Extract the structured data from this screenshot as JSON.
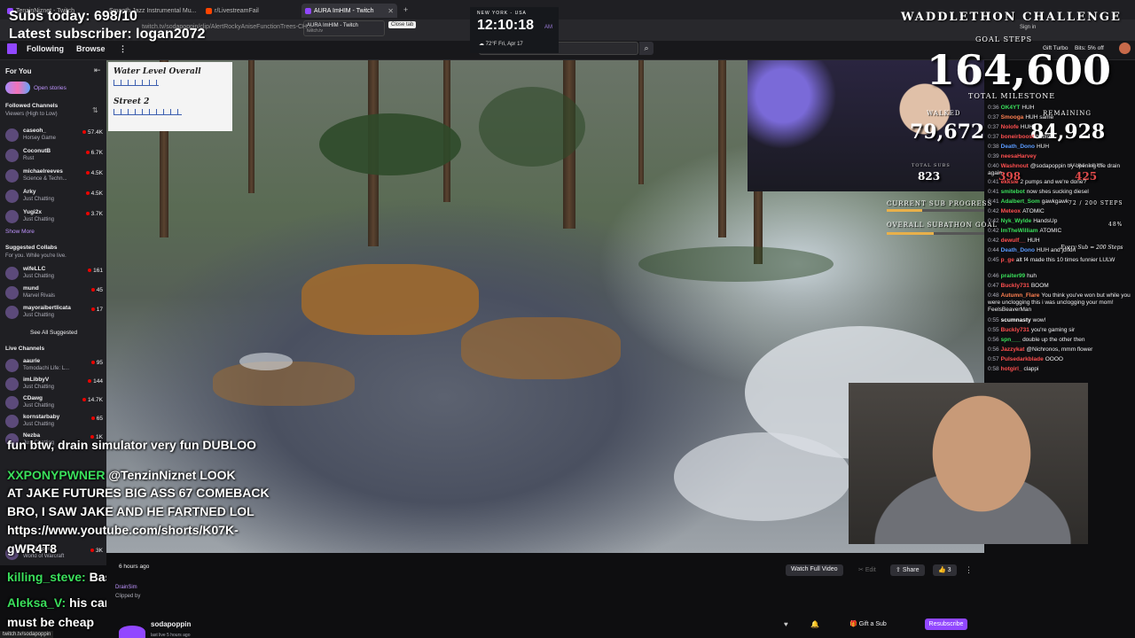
{
  "browser": {
    "tabs": [
      {
        "label": "TenzinNiznet - Twitch",
        "color": "#9147ff"
      },
      {
        "label": "Smooth Jazz Instrumental Mu...",
        "color": "#e03030"
      },
      {
        "label": "r/LivestreamFail",
        "color": "#ff4500"
      },
      {
        "label": "AURA ImHIM - Twitch",
        "color": "#9147ff"
      }
    ],
    "tab_tooltip": "AURA ImHIM - Twitch",
    "tab_tooltip_sub": "twitch.tv",
    "close_tab_tooltip": "Close tab",
    "url": "twitch.tv/sodapoppin/clip/AlertRockyAniseFunctionTrees-CH...",
    "sign_in": "Sign in",
    "gift_turbo": "Gift Turbo",
    "bits": "Bits: 5% off"
  },
  "nav": {
    "following": "Following",
    "browse": "Browse",
    "more": "⋮"
  },
  "sidebar": {
    "for_you": "For You",
    "open_stories": "Open stories",
    "followed_title": "Followed Channels",
    "followed_sort": "Viewers (High to Low)",
    "followed": [
      {
        "name": "caseoh_",
        "game": "Horsey Game",
        "viewers": "57.4K"
      },
      {
        "name": "CoconutB",
        "game": "Rust",
        "viewers": "6.7K"
      },
      {
        "name": "michaelreeves",
        "game": "Science & Techn...",
        "viewers": "4.5K"
      },
      {
        "name": "Arky",
        "game": "Just Chatting",
        "viewers": "4.5K"
      },
      {
        "name": "Yugi2x",
        "game": "Just Chatting",
        "viewers": "3.7K"
      }
    ],
    "show_more": "Show More",
    "suggested_title": "Suggested Collabs",
    "suggested_sub": "For you. While you're live.",
    "suggested": [
      {
        "name": "wifeLLC",
        "game": "Just Chatting",
        "viewers": "161"
      },
      {
        "name": "mund",
        "game": "Marvel Rivals",
        "viewers": "45"
      },
      {
        "name": "mayoraibertlicata",
        "game": "Just Chatting",
        "viewers": "17"
      }
    ],
    "see_all": "See All Suggested",
    "live_title": "Live Channels",
    "live": [
      {
        "name": "aaurie",
        "game": "Tomodachi Life: L...",
        "viewers": "95"
      },
      {
        "name": "imLibbyV",
        "game": "Just Chatting",
        "viewers": "144"
      },
      {
        "name": "CDawg",
        "game": "Just Chatting",
        "viewers": "14.7K"
      },
      {
        "name": "kornstarbaby",
        "game": "Just Chatting",
        "viewers": "65"
      },
      {
        "name": "Nezba",
        "game": "Just Chatting",
        "viewers": "1K"
      }
    ],
    "bottom_channel": {
      "name": "Pikaboom",
      "game": "World of Warcraft",
      "viewers": "3K"
    }
  },
  "overlay": {
    "subs_today": "Subs today: 698/10",
    "latest_sub": "Latest subscriber: logan2072",
    "water_title": "Water Level Overall",
    "street_title": "Street 2",
    "water_level": 0.4,
    "street_level": 0.6
  },
  "clock": {
    "city": "NEW YORK - USA",
    "time": "12:10:18",
    "ampm": "AM",
    "weather": "☁ 72°F  Fri, Apr 17"
  },
  "stats": {
    "title": "WADDLETHON CHALLENGE",
    "goal_steps": "GOAL STEPS",
    "big_number": "164,600",
    "total_milestone": "TOTAL MILESTONE",
    "walked_label": "WALKED",
    "walked": "79,672",
    "remaining_label": "REMAINING",
    "remaining": "84,928",
    "total_subs_label": "TOTAL SUBS",
    "total_subs": "823",
    "subs_count": "398",
    "subs_left_label": "SUBS LEFT",
    "subs_left": "425",
    "current_label": "CURRENT SUB PROGRESS",
    "current_value": "72 / 200 STEPS",
    "current_fraction": 0.36,
    "overall_label": "OVERALL SUBATHON GOAL",
    "overall_value": "48%",
    "overall_fraction": 0.48,
    "every_sub": "Every Sub = 200 Steps"
  },
  "chat": [
    {
      "t": "0:36",
      "u": "OK4YT",
      "c": "#3adf5b",
      "m": "HUH"
    },
    {
      "t": "0:37",
      "u": "Smooga",
      "c": "#ff7f50",
      "m": "HUH same"
    },
    {
      "t": "0:37",
      "u": "Nolofe",
      "c": "#ff4f4f",
      "m": "HUH"
    },
    {
      "t": "0:37",
      "u": "boneirboost",
      "c": "#ff4f4f",
      "m": "bablow"
    },
    {
      "t": "0:38",
      "u": "Death_Dono",
      "c": "#5a9bff",
      "m": "HUH"
    },
    {
      "t": "0:39",
      "u": "neesaHarvey",
      "c": "#ff4f4f",
      "m": ""
    },
    {
      "t": "0:40",
      "u": "Washnout",
      "c": "#ff4f4f",
      "m": "@sodapoppin try opening the drain again"
    },
    {
      "t": "0:41",
      "u": "ekksie",
      "c": "#ff4f4f",
      "m": "2 pumps and we're done?"
    },
    {
      "t": "0:41",
      "u": "smitebot",
      "c": "#3adf5b",
      "m": "now shes sucking diesel"
    },
    {
      "t": "0:41",
      "u": "Adalbert_Som",
      "c": "#3adf5b",
      "m": "gawkgawk"
    },
    {
      "t": "0:42",
      "u": "Meteox",
      "c": "#ff4f4f",
      "m": "ATOMIC"
    },
    {
      "t": "0:42",
      "u": "Nyk_Wylde",
      "c": "#3adf5b",
      "m": "HandsUp"
    },
    {
      "t": "0:42",
      "u": "ImTheWilliam",
      "c": "#3adf5b",
      "m": "ATOMIC"
    },
    {
      "t": "0:42",
      "u": "dewulf__",
      "c": "#ff4f4f",
      "m": "HUH"
    },
    {
      "t": "0:44",
      "u": "Death_Dono",
      "c": "#5a9bff",
      "m": "HUH and jorkin"
    },
    {
      "t": "0:45",
      "u": "p_ge",
      "c": "#ff4f4f",
      "m": "alt f4 made this 10 times funnier LULW"
    },
    {
      "t": "0:46",
      "u": "praiter99",
      "c": "#3adf5b",
      "m": "huh"
    },
    {
      "t": "0:47",
      "u": "Buckly731",
      "c": "#ff4f4f",
      "m": "BOOM"
    },
    {
      "t": "0:48",
      "u": "Autumn_Flare",
      "c": "#ff7f50",
      "m": "You think you've won but while you were unclogging this i was unclogging your mom! FeelsBeaverMan"
    },
    {
      "t": "0:55",
      "u": "scumnasty",
      "c": "#ffffff",
      "m": "wow!"
    },
    {
      "t": "0:55",
      "u": "Buckly731",
      "c": "#ff4f4f",
      "m": "you're gaming sir"
    },
    {
      "t": "0:56",
      "u": "spn___",
      "c": "#3adf5b",
      "m": "double up the other then"
    },
    {
      "t": "0:56",
      "u": "Jazzykat",
      "c": "#ff4f4f",
      "m": "@Nichronos, mmm flower"
    },
    {
      "t": "0:57",
      "u": "Pulsedarkblade",
      "c": "#ff4f4f",
      "m": "OOOO"
    },
    {
      "t": "0:58",
      "u": "hotgirl_",
      "c": "#ff4f4f",
      "m": "clappi"
    }
  ],
  "overlay_chat": [
    {
      "u": "",
      "m": "fun btw, drain simulator very fun DUBLOO"
    },
    {
      "u": "XXPONYPWNER",
      "m": "@TenzinNiznet LOOK"
    },
    {
      "u": "",
      "m": "AT JAKE FUTURES BIG ASS 67 COMEBACK"
    },
    {
      "u": "",
      "m": "BRO, I SAW JAKE AND HE FARTNED LOL"
    },
    {
      "u": "",
      "m": "https://www.youtube.com/shorts/K07K-"
    },
    {
      "u": "",
      "m": "gWR4T8"
    },
    {
      "u": "killing_steve:",
      "m": "BasedGod"
    },
    {
      "u": "Aleksa_V:",
      "m": "his camera looks like shit,"
    },
    {
      "u": "",
      "m": "must be cheap"
    }
  ],
  "clip": {
    "ago": "6 hours ago",
    "game": "DrainSim",
    "clipped_by": "Clipped by",
    "channel": "sodapoppin",
    "live_for": "last live 5 hours ago",
    "watch_full": "Watch Full Video",
    "edit": "Edit",
    "share": "Share",
    "likes": "3",
    "gift_sub": "Gift a Sub",
    "resubscribe": "Resubscribe"
  },
  "status_url": "twitch.tv/sodapoppin"
}
